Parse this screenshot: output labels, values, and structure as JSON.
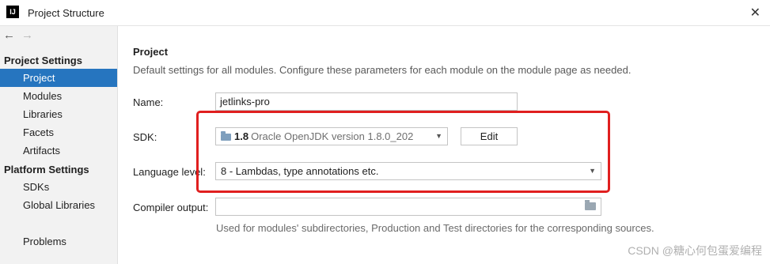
{
  "window": {
    "title": "Project Structure",
    "app_icon_text": "IJ",
    "close_icon": "close-icon"
  },
  "nav": {
    "back": "←",
    "forward": "→"
  },
  "sidebar": {
    "project_settings_header": "Project Settings",
    "project_items": [
      "Project",
      "Modules",
      "Libraries",
      "Facets",
      "Artifacts"
    ],
    "platform_settings_header": "Platform Settings",
    "platform_items": [
      "SDKs",
      "Global Libraries"
    ],
    "problems": "Problems",
    "selected": "Project"
  },
  "main": {
    "title": "Project",
    "description": "Default settings for all modules. Configure these parameters for each module on the module page as needed.",
    "name_label": "Name:",
    "name_value": "jetlinks-pro",
    "sdk_label": "SDK:",
    "sdk_version": "1.8",
    "sdk_description": "Oracle OpenJDK version 1.8.0_202",
    "edit_label": "Edit",
    "language_level_label": "Language level:",
    "language_level_value": "8 - Lambdas, type annotations etc.",
    "compiler_output_label": "Compiler output:",
    "compiler_output_value": "",
    "compiler_output_hint": "Used for modules' subdirectories, Production and Test directories for the corresponding sources."
  },
  "colors": {
    "selection": "#2675bf",
    "highlight": "#e01f1f"
  },
  "watermark": "CSDN @糖心何包蛋爱编程"
}
